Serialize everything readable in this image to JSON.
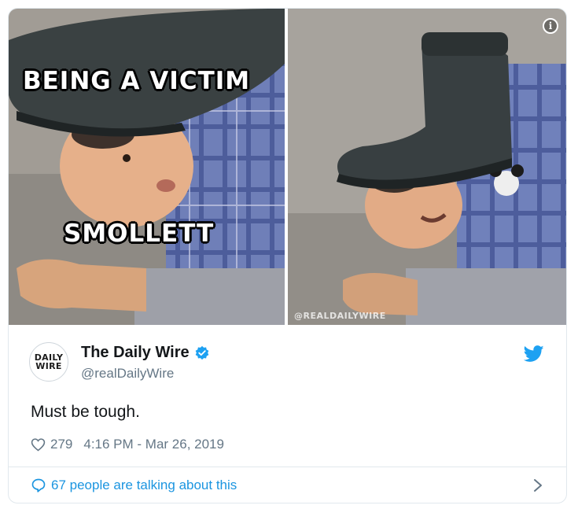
{
  "meme": {
    "top_caption": "BEING A VICTIM",
    "bottom_caption": "SMOLLETT",
    "watermark": "@REALDAILYWIRE"
  },
  "media_info_icon": "info-icon",
  "author": {
    "name": "The Daily Wire",
    "handle": "@realDailyWire",
    "avatar_line1": "DAILY",
    "avatar_line2": "WIRE",
    "verified": true
  },
  "tweet": {
    "text": "Must be tough.",
    "likes": "279",
    "timestamp": "4:16 PM - Mar 26, 2019"
  },
  "footer": {
    "talking_label": "67 people are talking about this"
  },
  "icons": {
    "like": "heart-outline-icon",
    "platform": "twitter-bird-icon",
    "verified": "verified-badge-icon",
    "conversation": "speech-bubble-icon",
    "more": "chevron-right-icon"
  },
  "colors": {
    "brand_blue": "#1da1f2",
    "link_blue": "#1b95e0",
    "secondary_text": "#657786",
    "border": "#e1e8ed"
  }
}
